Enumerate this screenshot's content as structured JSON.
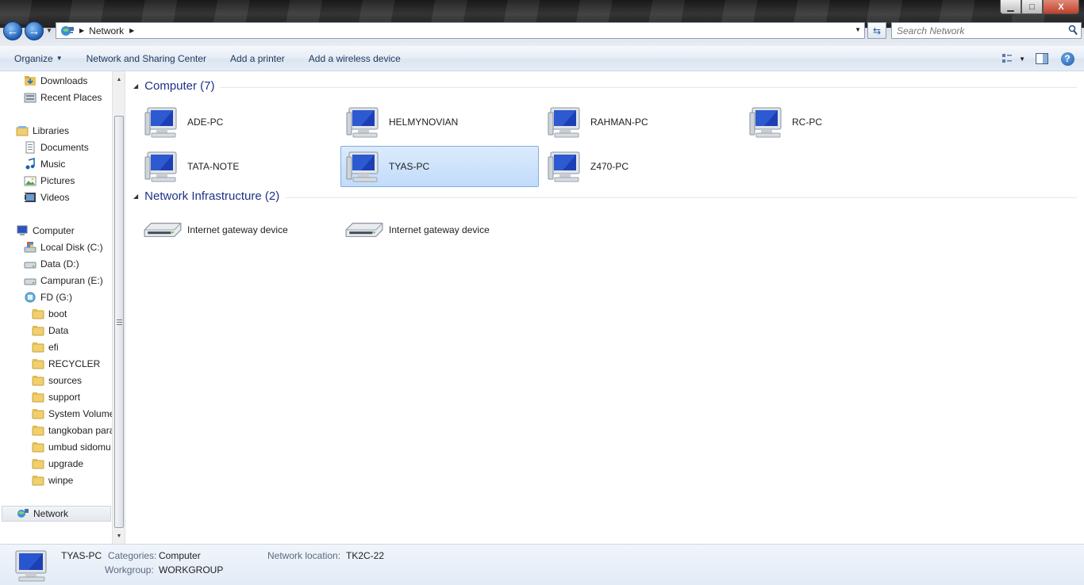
{
  "window": {
    "address": {
      "crumb": "Network"
    },
    "search": {
      "placeholder": "Search Network"
    },
    "buttons": {
      "minimize": "▁",
      "maximize": "□",
      "close": "X"
    }
  },
  "commandbar": {
    "items": [
      {
        "label": "Organize",
        "dropdown": true
      },
      {
        "label": "Network and Sharing Center"
      },
      {
        "label": "Add a printer"
      },
      {
        "label": "Add a wireless device"
      }
    ],
    "help": "?"
  },
  "sidebar": {
    "items": [
      {
        "label": "Downloads",
        "icon": "downloads-folder-icon"
      },
      {
        "label": "Recent Places",
        "icon": "recent-places-icon"
      },
      {
        "label": "Libraries",
        "icon": "libraries-icon"
      },
      {
        "label": "Documents",
        "icon": "documents-icon"
      },
      {
        "label": "Music",
        "icon": "music-icon"
      },
      {
        "label": "Pictures",
        "icon": "pictures-icon"
      },
      {
        "label": "Videos",
        "icon": "videos-icon"
      },
      {
        "label": "Computer",
        "icon": "computer-icon"
      },
      {
        "label": "Local Disk (C:)",
        "icon": "local-disk-icon"
      },
      {
        "label": "Data (D:)",
        "icon": "drive-icon"
      },
      {
        "label": "Campuran (E:)",
        "icon": "drive-icon"
      },
      {
        "label": "FD (G:)",
        "icon": "usb-drive-icon"
      },
      {
        "label": "boot",
        "icon": "folder-icon"
      },
      {
        "label": "Data",
        "icon": "folder-icon"
      },
      {
        "label": "efi",
        "icon": "folder-icon"
      },
      {
        "label": "RECYCLER",
        "icon": "folder-icon"
      },
      {
        "label": "sources",
        "icon": "folder-icon"
      },
      {
        "label": "support",
        "icon": "folder-icon"
      },
      {
        "label": "System Volume",
        "icon": "folder-icon"
      },
      {
        "label": "tangkoban para",
        "icon": "folder-icon"
      },
      {
        "label": "umbud sidomu",
        "icon": "folder-icon"
      },
      {
        "label": "upgrade",
        "icon": "folder-icon"
      },
      {
        "label": "winpe",
        "icon": "folder-icon"
      },
      {
        "label": "Network",
        "icon": "network-icon"
      }
    ]
  },
  "groups": [
    {
      "title": "Computer (7)",
      "items": [
        "ADE-PC",
        "HELMYNOVIAN",
        "RAHMAN-PC",
        "RC-PC",
        "TATA-NOTE",
        "TYAS-PC",
        "Z470-PC"
      ]
    },
    {
      "title": "Network Infrastructure (2)",
      "items": [
        "Internet gateway device",
        "Internet gateway device"
      ]
    }
  ],
  "details": {
    "name": "TYAS-PC",
    "categories_label": "Categories:",
    "categories_value": "Computer",
    "workgroup_label": "Workgroup:",
    "workgroup_value": "WORKGROUP",
    "location_label": "Network location:",
    "location_value": "TK2C-22"
  }
}
